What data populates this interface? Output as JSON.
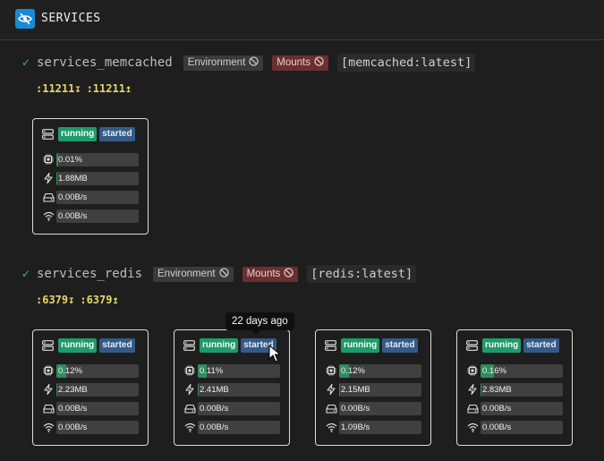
{
  "header": {
    "title": "SERVICES",
    "logo_icon": "eye-slash-icon"
  },
  "services": [
    {
      "name": "services_memcached",
      "env_label": "Environment",
      "mounts_label": "Mounts",
      "image": "[memcached:latest]",
      "ports": [
        ":11211↧",
        ":11211↥"
      ],
      "containers": [
        {
          "status": "running",
          "state": "started",
          "cpu": "0.01%",
          "cpu_fraction": 0.01,
          "mem": "1.88MB",
          "disk": "0.00B/s",
          "net": "0.00B/s"
        }
      ]
    },
    {
      "name": "services_redis",
      "env_label": "Environment",
      "mounts_label": "Mounts",
      "image": "[redis:latest]",
      "ports": [
        ":6379↧",
        ":6379↥"
      ],
      "containers": [
        {
          "status": "running",
          "state": "started",
          "cpu": "0.12%",
          "cpu_fraction": 0.12,
          "mem": "2.23MB",
          "disk": "0.00B/s",
          "net": "0.00B/s"
        },
        {
          "status": "running",
          "state": "started",
          "cpu": "0.11%",
          "cpu_fraction": 0.11,
          "mem": "2.41MB",
          "disk": "0.00B/s",
          "net": "0.00B/s"
        },
        {
          "status": "running",
          "state": "started",
          "cpu": "0.12%",
          "cpu_fraction": 0.12,
          "mem": "2.15MB",
          "disk": "0.00B/s",
          "net": "1.09B/s"
        },
        {
          "status": "running",
          "state": "started",
          "cpu": "0.16%",
          "cpu_fraction": 0.16,
          "mem": "2.83MB",
          "disk": "0.00B/s",
          "net": "0.00B/s"
        }
      ]
    }
  ],
  "tooltip": {
    "text": "22 days ago"
  },
  "colors": {
    "accent": "#1a8ad4",
    "running": "#1f9a6a",
    "started": "#355a86",
    "mounts": "#6b2f2f",
    "ports": "#e6d96a",
    "check": "#2ec27e"
  }
}
